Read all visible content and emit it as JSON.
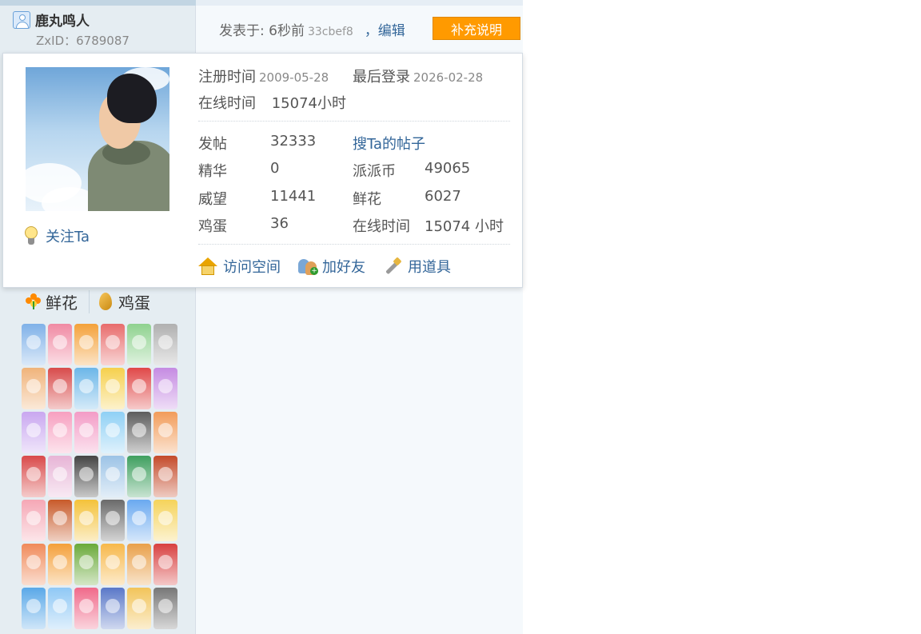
{
  "user": {
    "name": "鹿丸鸣人",
    "zxid_text": "ZxID：6789087"
  },
  "post": {
    "posted_prefix": "发表于: 6秒前",
    "hash": "33cbef8",
    "edit_label": "，编辑",
    "supplement_label": "补充说明"
  },
  "popup": {
    "reg_label": "注册时间",
    "reg_date": "2009-05-28",
    "last_login_label": "最后登录",
    "last_login_date": "2026-02-28",
    "online_label": "在线时间",
    "online_value": "15074小时",
    "follow_label": "关注Ta",
    "stats": {
      "posts_label": "发帖",
      "posts_value": "32333",
      "search_posts_label": "搜Ta的帖子",
      "digest_label": "精华",
      "digest_value": "0",
      "coins_label": "派派币",
      "coins_value": "49065",
      "prestige_label": "威望",
      "prestige_value": "11441",
      "flowers_label": "鲜花",
      "flowers_value": "6027",
      "eggs_label": "鸡蛋",
      "eggs_value": "36",
      "online2_label": "在线时间",
      "online2_value": "15074 小时"
    },
    "links": {
      "visit_space": "访问空间",
      "add_friend": "加好友",
      "use_tool": "用道具"
    }
  },
  "actions": {
    "flower_label": "鲜花",
    "egg_label": "鸡蛋"
  },
  "icons": [
    "user-icon",
    "bulb-icon",
    "house-icon",
    "friends-icon",
    "tool-icon",
    "flower-icon",
    "egg-icon"
  ],
  "colors": {
    "accent_button": "#ff9a00",
    "link": "#336699",
    "sidebar_bg": "#e5edf2"
  },
  "medal_colors": [
    "#7fb1e8",
    "#f08aa3",
    "#f4a13a",
    "#e86c6c",
    "#8fd28f",
    "#b0b0b0",
    "#f0b37a",
    "#d84b4b",
    "#6cb6e8",
    "#f6d04d",
    "#e04848",
    "#c58be2",
    "#c9a7f0",
    "#f7a0c0",
    "#f39cc6",
    "#8fd0f5",
    "#5d5d5d",
    "#f29c5a",
    "#d94a4a",
    "#e7b4d6",
    "#444444",
    "#9cc3e6",
    "#3f9f5f",
    "#c44a2a",
    "#f5a7b5",
    "#c85a2a",
    "#f4c23a",
    "#6a6a6a",
    "#6aa9f0",
    "#f5d35a",
    "#f08a5a",
    "#f4a03a",
    "#6aaa3a",
    "#f7b84a",
    "#e9a04a",
    "#d84040",
    "#5aa8e8",
    "#8fc8f5",
    "#f06a8a",
    "#5a78c8",
    "#f2c45a",
    "#777777"
  ]
}
